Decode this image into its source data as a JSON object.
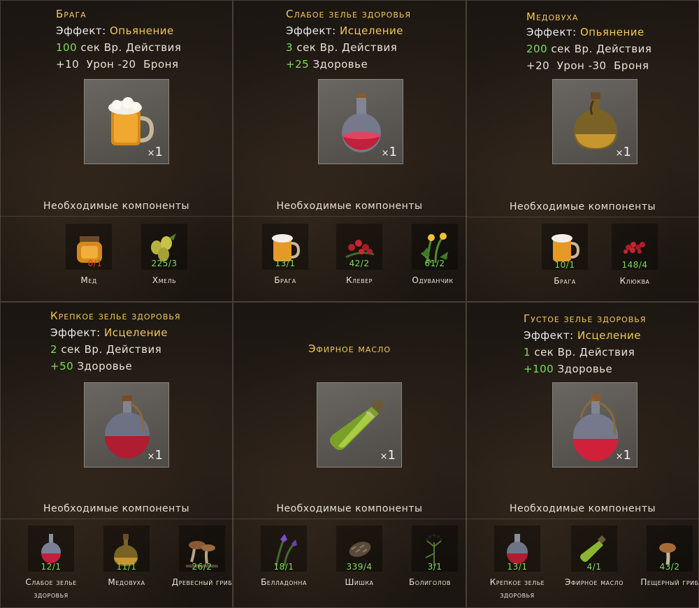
{
  "common": {
    "effect_label": "Эффект:",
    "duration_suffix": "сек Вр. Действия",
    "components_title": "Необходимые компоненты",
    "health_label": "Здоровье"
  },
  "cards": [
    {
      "title": "Брага",
      "effect": "Опьянение",
      "duration": "100",
      "stats": "+10  Урон -20  Броня",
      "qty": "1",
      "components": [
        {
          "name": "Мед",
          "count": "0/1",
          "count_state": "insufficient",
          "icon": "honey-jar-icon"
        },
        {
          "name": "Хмель",
          "count": "225/3",
          "count_state": "ok",
          "icon": "hops-icon"
        }
      ]
    },
    {
      "title": "Слабое зелье здоровья",
      "effect": "Исцеление",
      "duration": "3",
      "health": "+25",
      "qty": "1",
      "components": [
        {
          "name": "Брага",
          "count": "13/1",
          "count_state": "ok",
          "icon": "beer-mug-icon"
        },
        {
          "name": "Клевер",
          "count": "42/2",
          "count_state": "ok",
          "icon": "clover-icon"
        },
        {
          "name": "Одуванчик",
          "count": "61/2",
          "count_state": "ok",
          "icon": "dandelion-icon"
        }
      ]
    },
    {
      "title": "Медовуха",
      "effect": "Опьянение",
      "duration": "200",
      "stats": "+20  Урон -30  Броня",
      "qty": "1",
      "components": [
        {
          "name": "Брага",
          "count": "10/1",
          "count_state": "ok",
          "icon": "beer-mug-icon"
        },
        {
          "name": "Клюква",
          "count": "148/4",
          "count_state": "ok",
          "icon": "cranberry-icon"
        }
      ]
    },
    {
      "title": "Крепкое зелье здоровья",
      "effect": "Исцеление",
      "duration": "2",
      "health": "+50",
      "qty": "1",
      "components": [
        {
          "name": "Слабое зелье здоровья",
          "count": "12/1",
          "count_state": "ok",
          "icon": "small-potion-icon"
        },
        {
          "name": "Медовуха",
          "count": "11/1",
          "count_state": "ok",
          "icon": "mead-flask-icon"
        },
        {
          "name": "Древесный гриб",
          "count": "26/2",
          "count_state": "ok",
          "icon": "tree-mushroom-icon"
        }
      ]
    },
    {
      "title": "Эфирное масло",
      "qty": "1",
      "components": [
        {
          "name": "Белладонна",
          "count": "18/1",
          "count_state": "ok",
          "icon": "belladonna-icon"
        },
        {
          "name": "Шишка",
          "count": "339/4",
          "count_state": "ok",
          "icon": "pine-cone-icon"
        },
        {
          "name": "Болиголов",
          "count": "3/1",
          "count_state": "ok",
          "icon": "hemlock-icon"
        }
      ]
    },
    {
      "title": "Густое зелье здоровья",
      "effect": "Исцеление",
      "duration": "1",
      "health": "+100",
      "qty": "1",
      "components": [
        {
          "name": "Крепкое зелье здоровья",
          "count": "13/1",
          "count_state": "ok",
          "icon": "strong-potion-icon"
        },
        {
          "name": "Эфирное масло",
          "count": "4/1",
          "count_state": "ok",
          "icon": "oil-bottle-icon"
        },
        {
          "name": "Пещерный гриб",
          "count": "43/2",
          "count_state": "ok",
          "icon": "cave-mushroom-icon"
        }
      ]
    }
  ],
  "colors": {
    "effect": "#f1c95a",
    "value": "#7cdc5a",
    "insufficient": "#e03a2a"
  }
}
